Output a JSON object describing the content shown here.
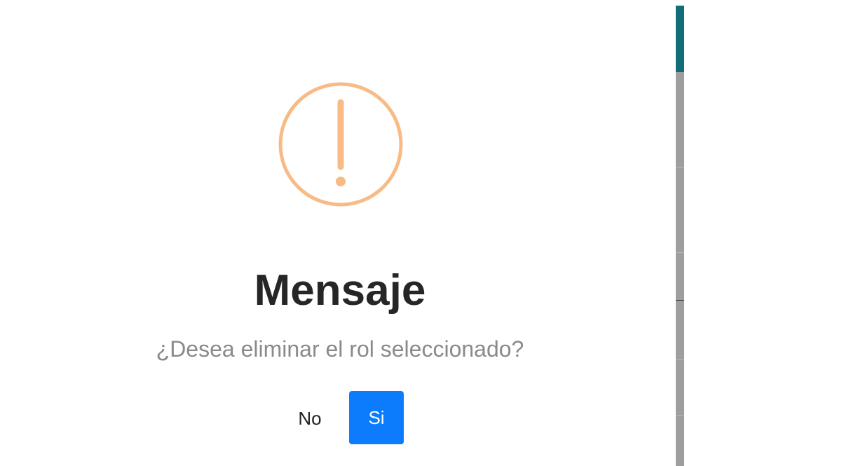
{
  "dialog": {
    "icon": "exclamation-circle-icon",
    "icon_color": "#f8bb86",
    "title": "Mensaje",
    "message": "¿Desea eliminar el rol seleccionado?",
    "cancel_label": "No",
    "confirm_label": "Si",
    "confirm_color": "#0d7cfc"
  },
  "background": {
    "accent_color": "#136d78",
    "overlay_color": "#9e9e9e"
  }
}
